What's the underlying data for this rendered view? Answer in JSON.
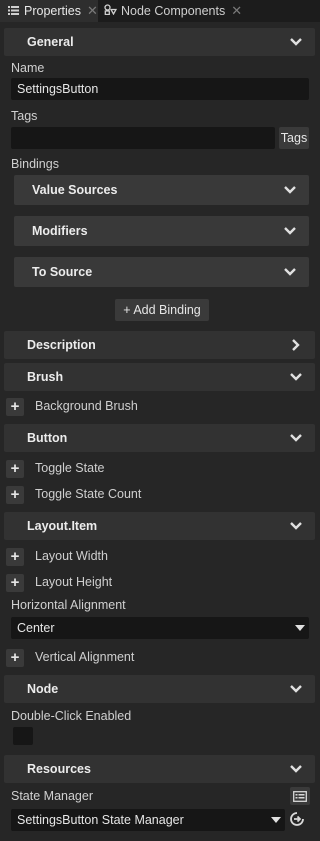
{
  "tabs": [
    {
      "label": "Properties",
      "icon": "list-icon",
      "active": true
    },
    {
      "label": "Node Components",
      "icon": "components-icon",
      "active": false
    }
  ],
  "sections": {
    "general": "General",
    "description": "Description",
    "brush": "Brush",
    "button": "Button",
    "layout_item": "Layout.Item",
    "node": "Node",
    "resources": "Resources"
  },
  "general": {
    "name_label": "Name",
    "name_value": "SettingsButton",
    "tags_label": "Tags",
    "tags_value": "",
    "tags_button": "Tags",
    "bindings_label": "Bindings",
    "bindings": [
      "Value Sources",
      "Modifiers",
      "To Source"
    ],
    "add_binding": "+ Add Binding"
  },
  "brush": {
    "items": [
      "Background Brush"
    ]
  },
  "button": {
    "items": [
      "Toggle State",
      "Toggle State Count"
    ]
  },
  "layout": {
    "items": [
      "Layout Width",
      "Layout Height"
    ],
    "halign_label": "Horizontal Alignment",
    "halign_value": "Center",
    "valign_item": "Vertical Alignment"
  },
  "node": {
    "double_click_label": "Double-Click Enabled",
    "double_click_checked": false
  },
  "resources": {
    "state_manager_label": "State Manager",
    "state_manager_value": "SettingsButton State Manager"
  },
  "colors": {
    "background": "#262626",
    "panel": "#323232",
    "field": "#161616",
    "text": "#d6d6d6"
  }
}
